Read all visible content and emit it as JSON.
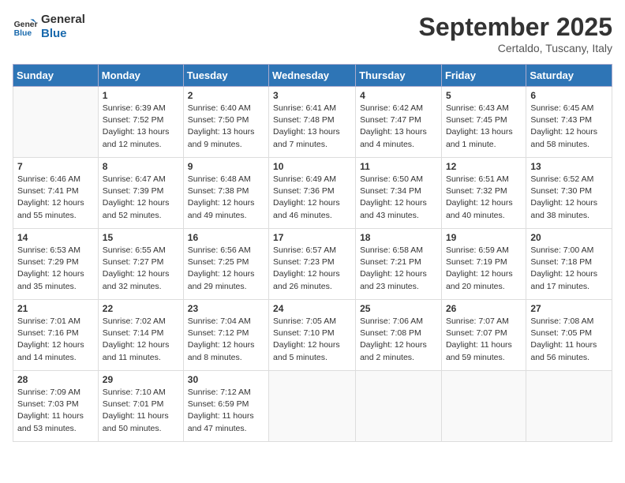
{
  "logo": {
    "line1": "General",
    "line2": "Blue"
  },
  "title": "September 2025",
  "location": "Certaldo, Tuscany, Italy",
  "days_of_week": [
    "Sunday",
    "Monday",
    "Tuesday",
    "Wednesday",
    "Thursday",
    "Friday",
    "Saturday"
  ],
  "weeks": [
    [
      {
        "day": "",
        "info": ""
      },
      {
        "day": "1",
        "info": "Sunrise: 6:39 AM\nSunset: 7:52 PM\nDaylight: 13 hours\nand 12 minutes."
      },
      {
        "day": "2",
        "info": "Sunrise: 6:40 AM\nSunset: 7:50 PM\nDaylight: 13 hours\nand 9 minutes."
      },
      {
        "day": "3",
        "info": "Sunrise: 6:41 AM\nSunset: 7:48 PM\nDaylight: 13 hours\nand 7 minutes."
      },
      {
        "day": "4",
        "info": "Sunrise: 6:42 AM\nSunset: 7:47 PM\nDaylight: 13 hours\nand 4 minutes."
      },
      {
        "day": "5",
        "info": "Sunrise: 6:43 AM\nSunset: 7:45 PM\nDaylight: 13 hours\nand 1 minute."
      },
      {
        "day": "6",
        "info": "Sunrise: 6:45 AM\nSunset: 7:43 PM\nDaylight: 12 hours\nand 58 minutes."
      }
    ],
    [
      {
        "day": "7",
        "info": "Sunrise: 6:46 AM\nSunset: 7:41 PM\nDaylight: 12 hours\nand 55 minutes."
      },
      {
        "day": "8",
        "info": "Sunrise: 6:47 AM\nSunset: 7:39 PM\nDaylight: 12 hours\nand 52 minutes."
      },
      {
        "day": "9",
        "info": "Sunrise: 6:48 AM\nSunset: 7:38 PM\nDaylight: 12 hours\nand 49 minutes."
      },
      {
        "day": "10",
        "info": "Sunrise: 6:49 AM\nSunset: 7:36 PM\nDaylight: 12 hours\nand 46 minutes."
      },
      {
        "day": "11",
        "info": "Sunrise: 6:50 AM\nSunset: 7:34 PM\nDaylight: 12 hours\nand 43 minutes."
      },
      {
        "day": "12",
        "info": "Sunrise: 6:51 AM\nSunset: 7:32 PM\nDaylight: 12 hours\nand 40 minutes."
      },
      {
        "day": "13",
        "info": "Sunrise: 6:52 AM\nSunset: 7:30 PM\nDaylight: 12 hours\nand 38 minutes."
      }
    ],
    [
      {
        "day": "14",
        "info": "Sunrise: 6:53 AM\nSunset: 7:29 PM\nDaylight: 12 hours\nand 35 minutes."
      },
      {
        "day": "15",
        "info": "Sunrise: 6:55 AM\nSunset: 7:27 PM\nDaylight: 12 hours\nand 32 minutes."
      },
      {
        "day": "16",
        "info": "Sunrise: 6:56 AM\nSunset: 7:25 PM\nDaylight: 12 hours\nand 29 minutes."
      },
      {
        "day": "17",
        "info": "Sunrise: 6:57 AM\nSunset: 7:23 PM\nDaylight: 12 hours\nand 26 minutes."
      },
      {
        "day": "18",
        "info": "Sunrise: 6:58 AM\nSunset: 7:21 PM\nDaylight: 12 hours\nand 23 minutes."
      },
      {
        "day": "19",
        "info": "Sunrise: 6:59 AM\nSunset: 7:19 PM\nDaylight: 12 hours\nand 20 minutes."
      },
      {
        "day": "20",
        "info": "Sunrise: 7:00 AM\nSunset: 7:18 PM\nDaylight: 12 hours\nand 17 minutes."
      }
    ],
    [
      {
        "day": "21",
        "info": "Sunrise: 7:01 AM\nSunset: 7:16 PM\nDaylight: 12 hours\nand 14 minutes."
      },
      {
        "day": "22",
        "info": "Sunrise: 7:02 AM\nSunset: 7:14 PM\nDaylight: 12 hours\nand 11 minutes."
      },
      {
        "day": "23",
        "info": "Sunrise: 7:04 AM\nSunset: 7:12 PM\nDaylight: 12 hours\nand 8 minutes."
      },
      {
        "day": "24",
        "info": "Sunrise: 7:05 AM\nSunset: 7:10 PM\nDaylight: 12 hours\nand 5 minutes."
      },
      {
        "day": "25",
        "info": "Sunrise: 7:06 AM\nSunset: 7:08 PM\nDaylight: 12 hours\nand 2 minutes."
      },
      {
        "day": "26",
        "info": "Sunrise: 7:07 AM\nSunset: 7:07 PM\nDaylight: 11 hours\nand 59 minutes."
      },
      {
        "day": "27",
        "info": "Sunrise: 7:08 AM\nSunset: 7:05 PM\nDaylight: 11 hours\nand 56 minutes."
      }
    ],
    [
      {
        "day": "28",
        "info": "Sunrise: 7:09 AM\nSunset: 7:03 PM\nDaylight: 11 hours\nand 53 minutes."
      },
      {
        "day": "29",
        "info": "Sunrise: 7:10 AM\nSunset: 7:01 PM\nDaylight: 11 hours\nand 50 minutes."
      },
      {
        "day": "30",
        "info": "Sunrise: 7:12 AM\nSunset: 6:59 PM\nDaylight: 11 hours\nand 47 minutes."
      },
      {
        "day": "",
        "info": ""
      },
      {
        "day": "",
        "info": ""
      },
      {
        "day": "",
        "info": ""
      },
      {
        "day": "",
        "info": ""
      }
    ]
  ]
}
